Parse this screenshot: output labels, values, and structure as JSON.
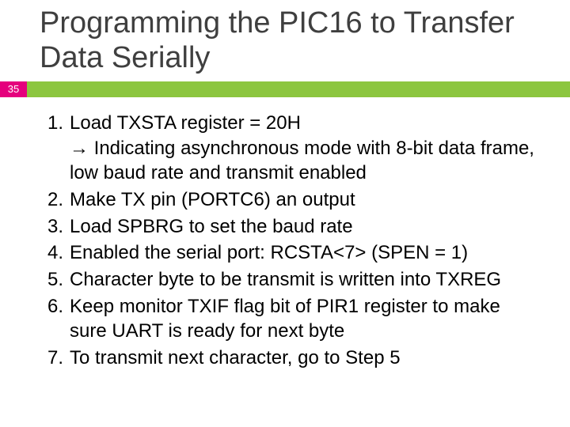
{
  "page_number": "35",
  "title": "Programming the PIC16 to Transfer Data Serially",
  "steps": {
    "s1_main": "Load TXSTA register = 20H",
    "s1_sub": "→ Indicating asynchronous mode with 8-bit data frame, low baud rate and transmit enabled",
    "s2": "Make TX pin (PORTC6) an output",
    "s3": "Load SPBRG to set the baud rate",
    "s4": "Enabled the serial port: RCSTA<7> (SPEN = 1)",
    "s5": "Character byte to be transmit is written into TXREG",
    "s6": "Keep monitor TXIF flag bit of PIR1 register to make sure UART is ready for next byte",
    "s7": "To transmit next character, go to Step 5"
  }
}
